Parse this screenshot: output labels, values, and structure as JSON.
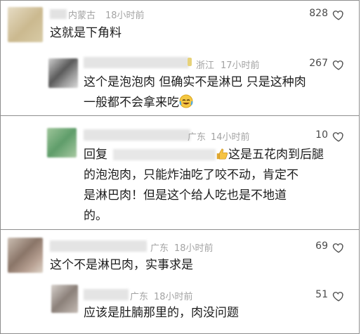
{
  "comments": [
    {
      "location": "内蒙古",
      "time": "18小时前",
      "text": "这就是下角料",
      "likes": "828"
    },
    {
      "location": "浙江",
      "time": "17小时前",
      "lines": [
        "这个是泡泡肉 但确实不是淋巴 只是这种肉",
        "一般都不会拿来吃"
      ],
      "likes": "267",
      "emoji": "laughing-crying-emoji"
    },
    {
      "location": "广东",
      "time": "14小时前",
      "reply_prefix": "回复",
      "lines": [
        "这是五花肉到后腿",
        "的泡泡肉，只能炸油吃了咬不动，肯定不",
        "是淋巴肉！但是这个给人吃也是不地道",
        "的。"
      ],
      "likes": "10",
      "emoji": "thumbs-up-emoji"
    },
    {
      "location": "广东",
      "time": "18小时前",
      "text": "这个不是淋巴肉，实事求是",
      "likes": "69"
    },
    {
      "location": "广东",
      "time": "18小时前",
      "text": "应该是肚腩那里的，肉没问题",
      "likes": "51"
    }
  ],
  "icons": {
    "like": "heart-outline-icon"
  }
}
